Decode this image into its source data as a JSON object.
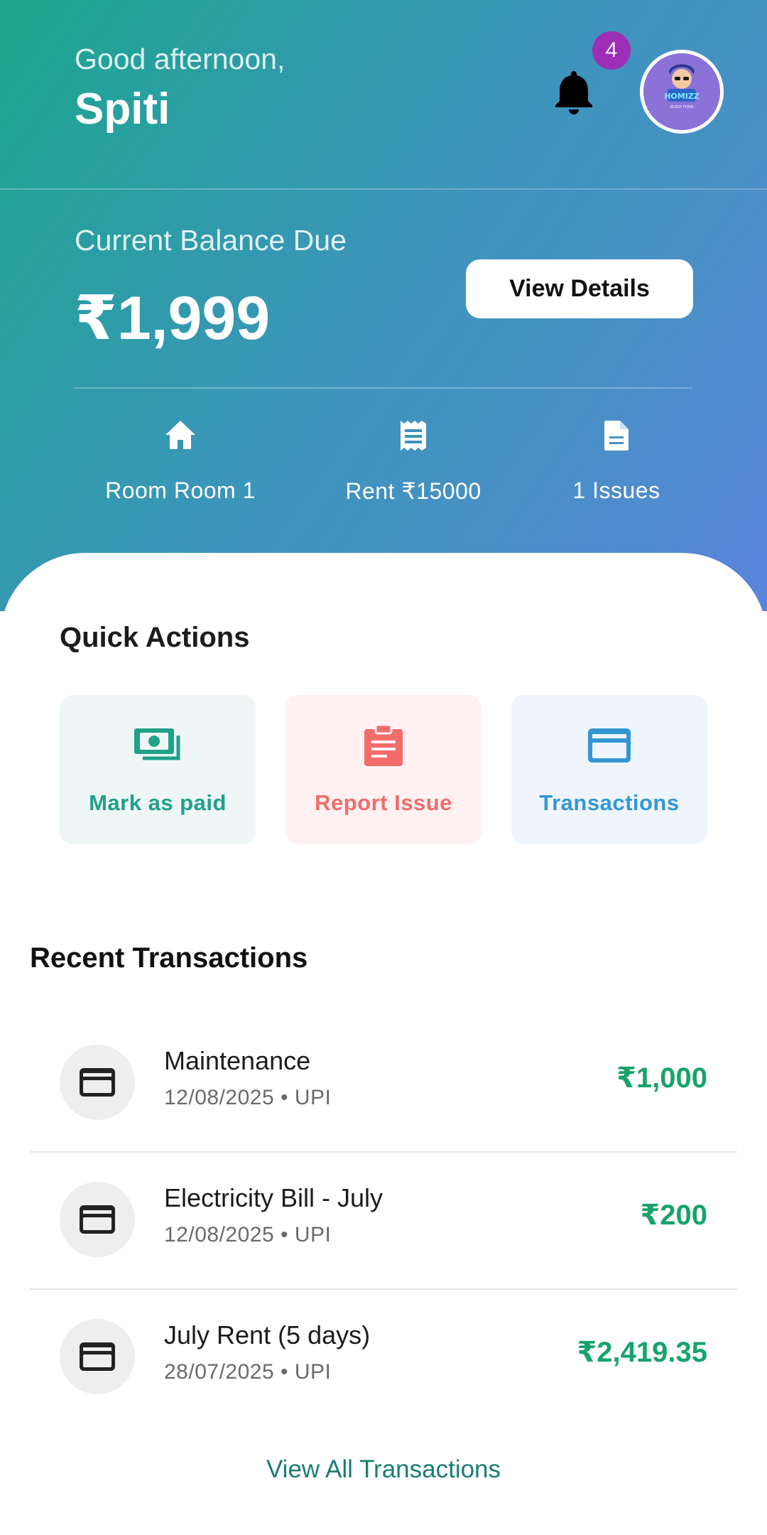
{
  "header": {
    "greeting": "Good afternoon,",
    "user_name": "Spiti",
    "notification_count": "4",
    "avatar_text": "HOMIZZ",
    "avatar_subtext": "DUSSY FOOD"
  },
  "balance": {
    "label": "Current Balance Due",
    "amount": "₹1,999",
    "view_details_label": "View Details"
  },
  "stats": [
    {
      "icon": "home-icon",
      "label": "Room Room 1"
    },
    {
      "icon": "receipt-icon",
      "label": "Rent ₹15000"
    },
    {
      "icon": "document-icon",
      "label": "1 Issues"
    }
  ],
  "quick_actions": {
    "title": "Quick Actions",
    "items": [
      {
        "icon": "cash-icon",
        "label": "Mark as paid",
        "color": "#21a08a",
        "bg": "#eef7f5"
      },
      {
        "icon": "clipboard-icon",
        "label": "Report Issue",
        "color": "#f26c6c",
        "bg": "#fff1f1"
      },
      {
        "icon": "credit-card-icon",
        "label": "Transactions",
        "color": "#3497d3",
        "bg": "#eef5fc"
      }
    ]
  },
  "recent_transactions": {
    "title": "Recent Transactions",
    "items": [
      {
        "title": "Maintenance",
        "meta": "12/08/2025 • UPI",
        "amount": "₹1,000"
      },
      {
        "title": "Electricity Bill - July",
        "meta": "12/08/2025 • UPI",
        "amount": "₹200"
      },
      {
        "title": "July Rent (5 days)",
        "meta": "28/07/2025 • UPI",
        "amount": "₹2,419.35"
      }
    ],
    "view_all_label": "View All Transactions"
  },
  "colors": {
    "accent_green": "#17a36a",
    "badge_purple": "#9c2fb5",
    "link_teal": "#1a7d73"
  }
}
